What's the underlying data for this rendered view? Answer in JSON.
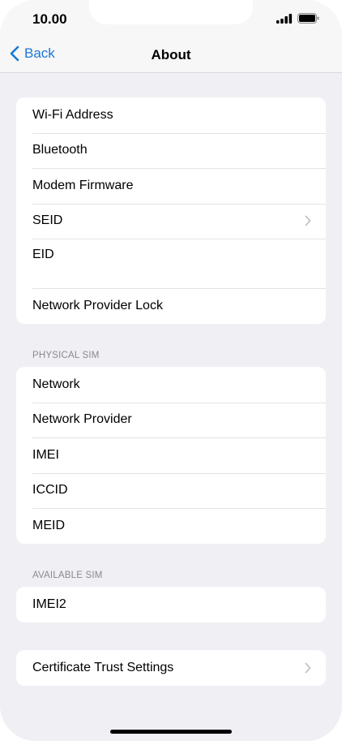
{
  "status_bar": {
    "time": "10.00",
    "signal_icon": "cellular-signal-icon",
    "battery_icon": "battery-icon"
  },
  "nav": {
    "back_label": "Back",
    "title": "About"
  },
  "groups": {
    "device": {
      "rows": [
        {
          "label": "Wi-Fi Address"
        },
        {
          "label": "Bluetooth"
        },
        {
          "label": "Modem Firmware"
        },
        {
          "label": "SEID",
          "chevron": true
        },
        {
          "label": "EID"
        },
        {
          "label": "Network Provider Lock"
        }
      ]
    },
    "physical_sim": {
      "header": "PHYSICAL SIM",
      "rows": [
        {
          "label": "Network"
        },
        {
          "label": "Network Provider"
        },
        {
          "label": "IMEI"
        },
        {
          "label": "ICCID"
        },
        {
          "label": "MEID"
        }
      ]
    },
    "available_sim": {
      "header": "AVAILABLE SIM",
      "rows": [
        {
          "label": "IMEI2"
        }
      ]
    },
    "certificates": {
      "rows": [
        {
          "label": "Certificate Trust Settings",
          "chevron": true
        }
      ]
    }
  },
  "colors": {
    "accent": "#1a78d6",
    "background": "#efeff4",
    "section_header": "#8a8a8e"
  }
}
